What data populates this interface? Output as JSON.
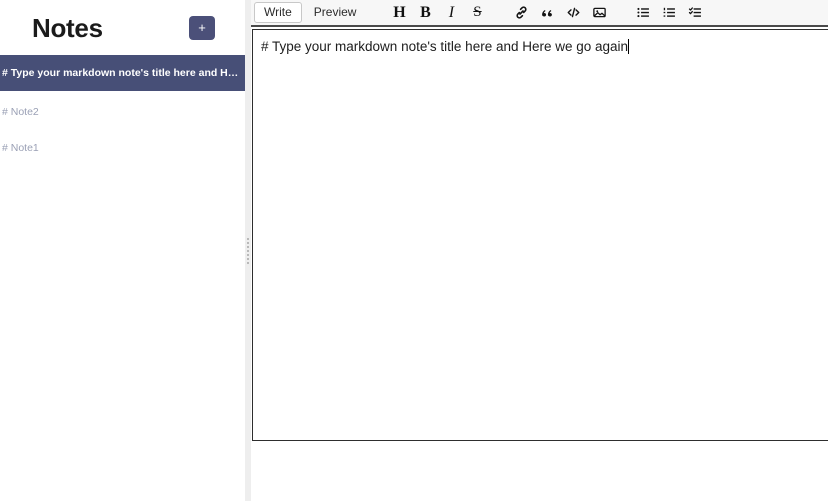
{
  "sidebar": {
    "title": "Notes",
    "add_button_label": "+",
    "notes": [
      {
        "label": "# Type your markdown note's title here and Here we go aga…",
        "selected": true
      },
      {
        "label": "# Note2",
        "selected": false
      },
      {
        "label": "# Note1",
        "selected": false
      }
    ]
  },
  "editor": {
    "tabs": [
      {
        "label": "Write",
        "active": true
      },
      {
        "label": "Preview",
        "active": false
      }
    ],
    "toolbar": {
      "heading": "H",
      "bold": "B",
      "italic": "I",
      "strikethrough": "S"
    },
    "content": "# Type your markdown note's title here and Here we go again"
  },
  "colors": {
    "accent": "#474f77",
    "accent_button": "#4b5079",
    "toolbar_bg": "#f7f7f7",
    "splitter_bg": "#eeeeee",
    "muted_text": "#9aa0b5"
  }
}
